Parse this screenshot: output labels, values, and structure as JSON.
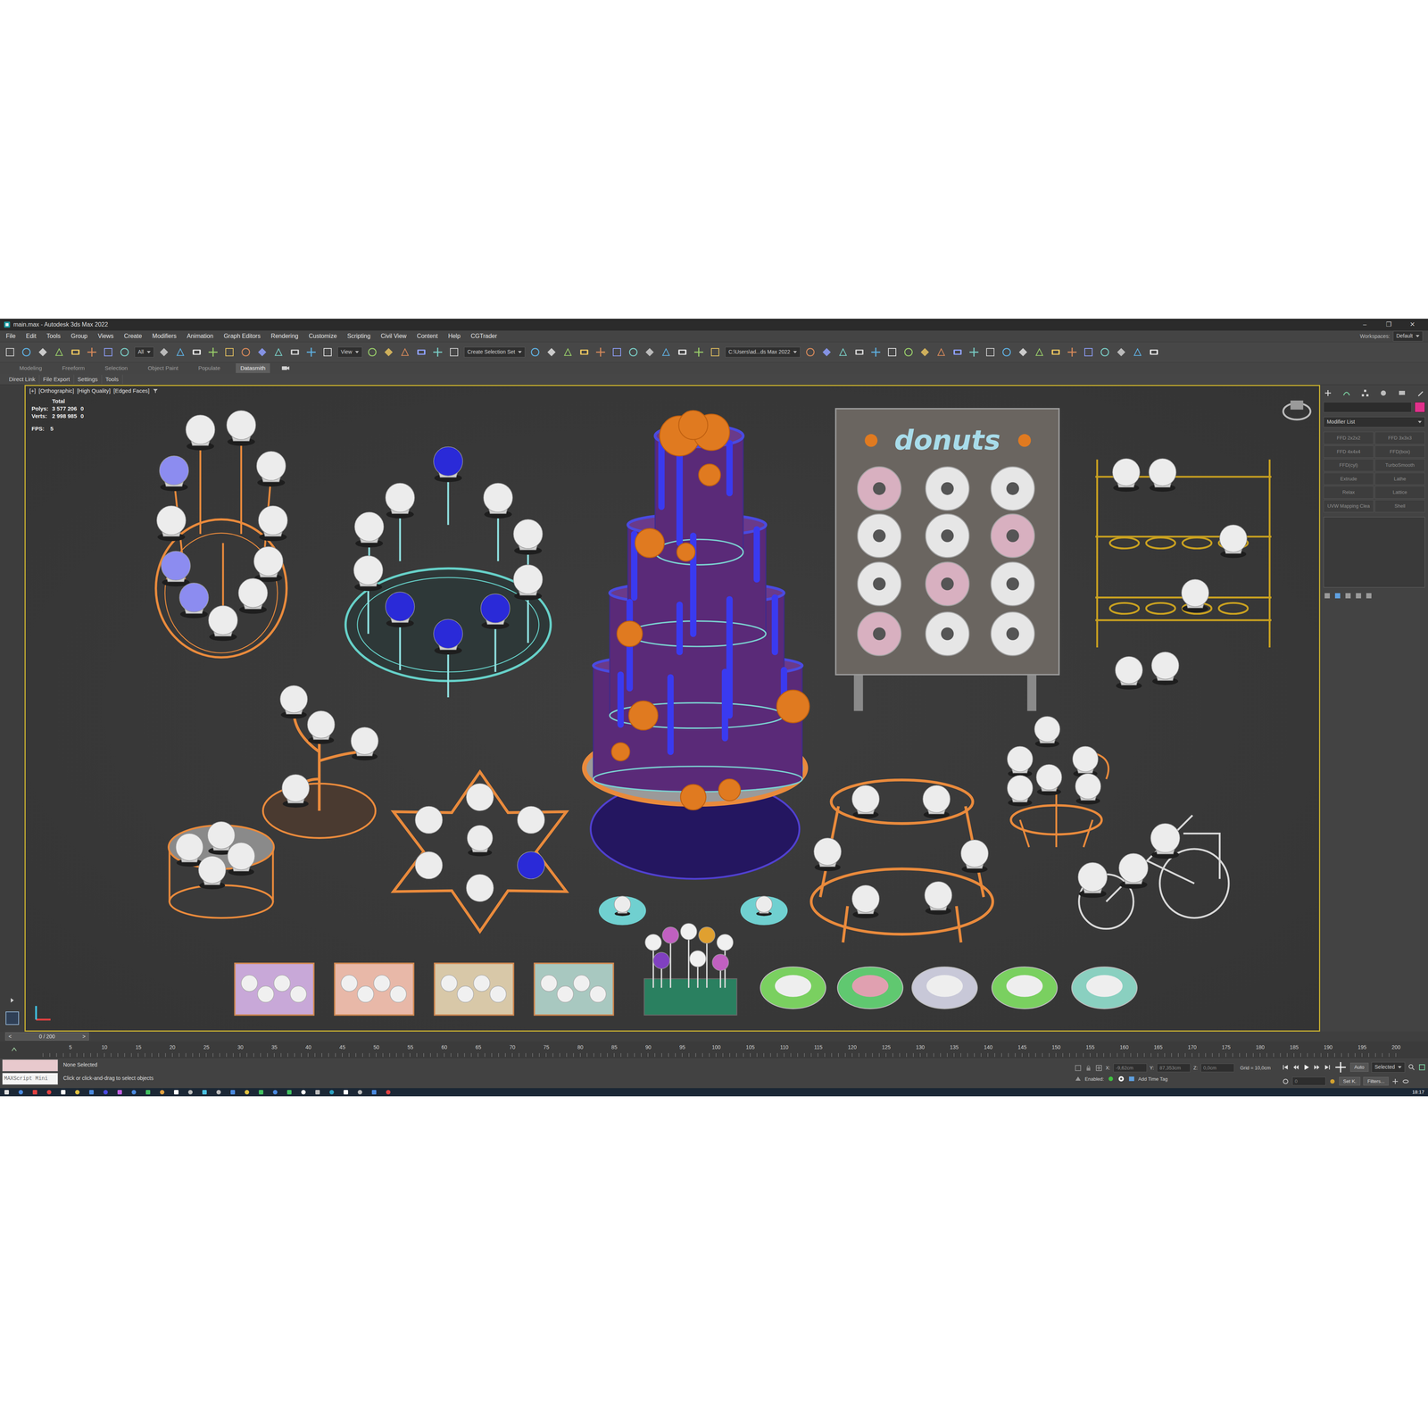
{
  "window": {
    "title": "main.max - Autodesk 3ds Max 2022",
    "controls": [
      "–",
      "❐",
      "✕"
    ]
  },
  "menu": [
    "File",
    "Edit",
    "Tools",
    "Group",
    "Views",
    "Create",
    "Modifiers",
    "Animation",
    "Graph Editors",
    "Rendering",
    "Customize",
    "Scripting",
    "Civil View",
    "Content",
    "Help",
    "CGTrader"
  ],
  "toolbar": {
    "filter": "All",
    "view": "View",
    "selection_set": "Create Selection Set",
    "path": "C:\\Users\\ad...ds Max 2022",
    "workspaces_label": "Workspaces:",
    "workspace": "Default"
  },
  "ribbon_tabs": [
    {
      "label": "Modeling",
      "selected": false
    },
    {
      "label": "Freeform",
      "selected": false
    },
    {
      "label": "Selection",
      "selected": false
    },
    {
      "label": "Object Paint",
      "selected": false
    },
    {
      "label": "Populate",
      "selected": false
    },
    {
      "label": "Datasmith",
      "selected": true
    }
  ],
  "ribbon_items": [
    "Direct Link",
    "File Export",
    "Settings",
    "Tools"
  ],
  "viewport": {
    "labels": [
      "[+]",
      "[Orthographic]",
      "[High Quality]",
      "[Edged Faces]"
    ],
    "stats": {
      "heading": "Total",
      "rows": [
        {
          "label": "Polys:",
          "total": "3 577 206",
          "selected": "0"
        },
        {
          "label": "Verts:",
          "total": "2 998 985",
          "selected": "0"
        }
      ],
      "fps_label": "FPS:",
      "fps": "5"
    }
  },
  "scene": {
    "sign": "donuts"
  },
  "command_panel": {
    "modifier_list": "Modifier List",
    "modifiers": [
      "FFD 2x2x2",
      "FFD 3x3x3",
      "FFD 4x4x4",
      "FFD(box)",
      "FFD(cyl)",
      "TurboSmooth",
      "Extrude",
      "Lathe",
      "Relax",
      "Lattice",
      "UVW Mapping Clea",
      "Shell"
    ]
  },
  "timeline": {
    "counter": "0 / 200",
    "prev": "<",
    "next": ">",
    "level": 0,
    "ticks": [
      "5",
      "10",
      "15",
      "20",
      "25",
      "30",
      "35",
      "40",
      "45",
      "50",
      "55",
      "60",
      "65",
      "70",
      "75",
      "80",
      "85",
      "90",
      "95",
      "100",
      "105",
      "110",
      "115",
      "120",
      "125",
      "130",
      "135",
      "140",
      "145",
      "150",
      "155",
      "160",
      "165",
      "170",
      "175",
      "180",
      "185",
      "190",
      "195",
      "200"
    ]
  },
  "status": {
    "maxscript": "MAXScript Mini",
    "selection": "None Selected",
    "prompt": "Click or click-and-drag to select objects",
    "coords": [
      {
        "axis": "X:",
        "value": "-9,62cm"
      },
      {
        "axis": "Y:",
        "value": "87,353cm"
      },
      {
        "axis": "Z:",
        "value": "0,0cm"
      }
    ],
    "grid": "Grid = 10,0cm",
    "enabled": "Enabled:",
    "time_tag": "Add Time Tag",
    "key_mode": "Auto",
    "key_filter": "Selected",
    "set_key": "Set K.",
    "filters": "Filters...",
    "frame": "0"
  },
  "taskbar": {
    "time": "18:17"
  }
}
